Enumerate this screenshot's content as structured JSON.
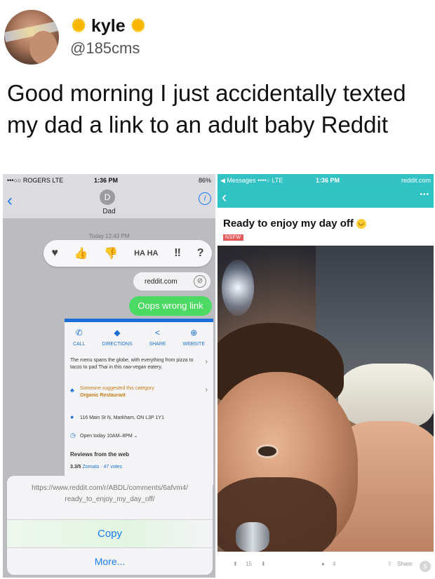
{
  "tweet": {
    "display_name": "kyle",
    "handle": "@185cms",
    "text": "Good morning I just accidentally texted my dad a link to an adult baby Reddit"
  },
  "left_screenshot": {
    "status": {
      "carrier": "•••○○ ROGERS  LTE",
      "time": "1:36 PM",
      "battery": "86%"
    },
    "contact": {
      "initial": "D",
      "name": "Dad"
    },
    "timestamp": "Today 12:43 PM",
    "tapbacks": [
      "♥",
      "👍",
      "👎",
      "HA HA",
      "‼",
      "?"
    ],
    "link_bubble": "reddit.com",
    "sent_message": "Oops wrong link",
    "place_card": {
      "actions": [
        {
          "label": "CALL",
          "icon": "phone-icon"
        },
        {
          "label": "DIRECTIONS",
          "icon": "directions-icon"
        },
        {
          "label": "SHARE",
          "icon": "share-icon"
        },
        {
          "label": "WEBSITE",
          "icon": "globe-icon"
        }
      ],
      "description": "The menu spans the globe, with everything from pizza to tacos to pad Thai in this raw-vegan eatery.",
      "suggestion_line1": "Someone suggested this category",
      "suggestion_line2": "Organic Restaurant",
      "address": "116 Main St N, Markham, ON L3P 1Y1",
      "hours": "Open today 10AM–8PM",
      "reviews_heading": "Reviews from the web",
      "rating": "3.3/5",
      "rating_source": "Zomato · 47 votes"
    },
    "action_sheet": {
      "url_line1": "https://www.reddit.com/r/ABDL/comments/6afvm4/",
      "url_line2": "ready_to_enjoy_my_day_off/",
      "copy_label": "Copy",
      "more_label": "More..."
    }
  },
  "right_screenshot": {
    "status": {
      "left": "◀ Messages ••••○  LTE",
      "time": "1:36 PM",
      "right": "reddit.com"
    },
    "menu_dots": "•••",
    "post_title": "Ready to enjoy my day off",
    "nsfw_tag": "NSFW",
    "footer": {
      "upvotes": "15",
      "comments": "4",
      "share_label": "Share"
    }
  }
}
